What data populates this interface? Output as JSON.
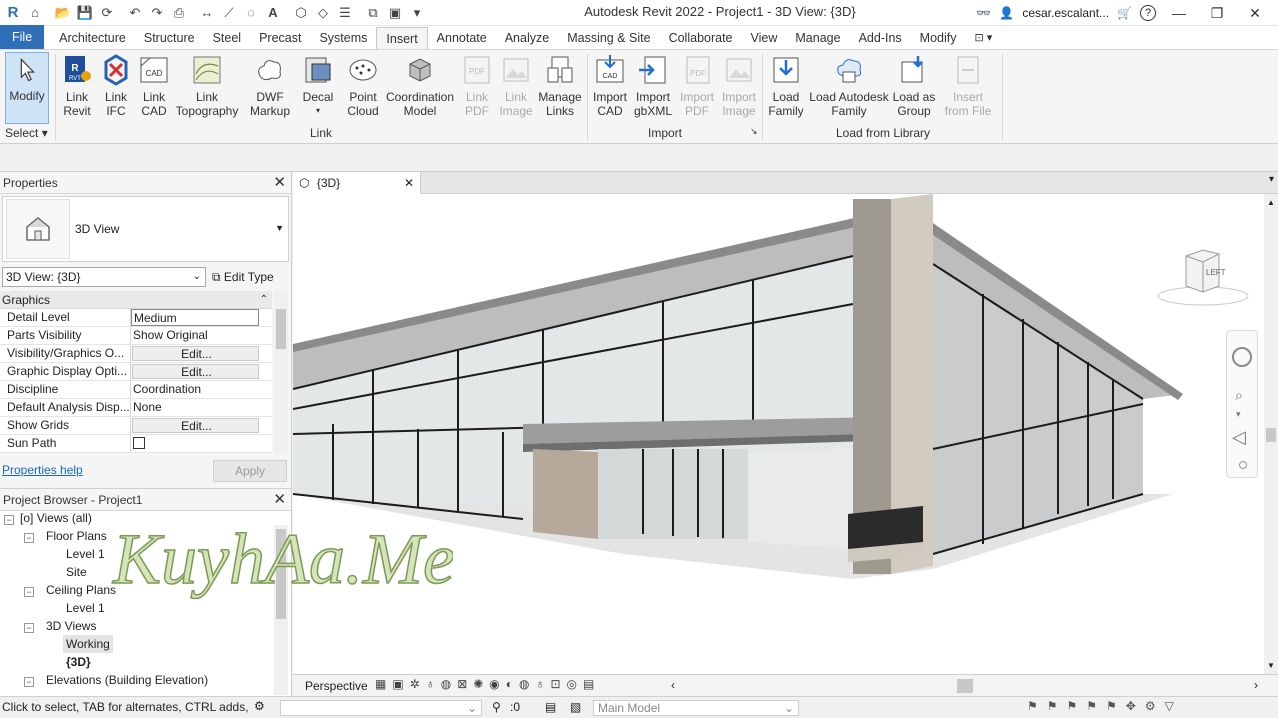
{
  "window": {
    "title": "Autodesk Revit 2022 - Project1 - 3D View: {3D}",
    "user": "cesar.escalant...",
    "app_icon": "R"
  },
  "tabs": [
    "File",
    "Architecture",
    "Structure",
    "Steel",
    "Precast",
    "Systems",
    "Insert",
    "Annotate",
    "Analyze",
    "Massing & Site",
    "Collaborate",
    "View",
    "Manage",
    "Add-Ins",
    "Modify"
  ],
  "active_tab": "Insert",
  "ribbon": {
    "modify": "Modify",
    "select_panel": "Select",
    "link_revit": [
      "Link",
      "Revit"
    ],
    "link_ifc": [
      "Link",
      "IFC"
    ],
    "link_cad": [
      "Link",
      "CAD"
    ],
    "link_topography": [
      "Link",
      "Topography"
    ],
    "dwf_markup": [
      "DWF",
      "Markup"
    ],
    "decal": "Decal",
    "point_cloud": [
      "Point",
      "Cloud"
    ],
    "coordination_model": [
      "Coordination",
      "Model"
    ],
    "link_pdf": [
      "Link",
      "PDF"
    ],
    "link_image": [
      "Link",
      "Image"
    ],
    "manage_links": [
      "Manage",
      "Links"
    ],
    "link_panel": "Link",
    "import_cad": [
      "Import",
      "CAD"
    ],
    "import_gbxml": [
      "Import",
      "gbXML"
    ],
    "import_pdf": [
      "Import",
      "PDF"
    ],
    "import_image": [
      "Import",
      "Image"
    ],
    "import_panel": "Import",
    "load_family": [
      "Load",
      "Family"
    ],
    "load_autodesk_family": [
      "Load Autodesk",
      "Family"
    ],
    "load_as_group": [
      "Load as",
      "Group"
    ],
    "insert_from_file": [
      "Insert",
      "from File"
    ],
    "load_panel": "Load from Library"
  },
  "properties": {
    "title": "Properties",
    "type_name": "3D View",
    "view_selector": "3D View: {3D}",
    "edit_type": "Edit Type",
    "group": "Graphics",
    "rows": [
      {
        "k": "Detail Level",
        "v": "Medium",
        "kind": "box"
      },
      {
        "k": "Parts Visibility",
        "v": "Show Original",
        "kind": "text"
      },
      {
        "k": "Visibility/Graphics O...",
        "v": "Edit...",
        "kind": "btn"
      },
      {
        "k": "Graphic Display Opti...",
        "v": "Edit...",
        "kind": "btn"
      },
      {
        "k": "Discipline",
        "v": "Coordination",
        "kind": "text"
      },
      {
        "k": "Default Analysis Disp...",
        "v": "None",
        "kind": "text"
      },
      {
        "k": "Show Grids",
        "v": "Edit...",
        "kind": "btn"
      },
      {
        "k": "Sun Path",
        "v": "",
        "kind": "check"
      }
    ],
    "help": "Properties help",
    "apply": "Apply"
  },
  "browser": {
    "title": "Project Browser - Project1",
    "items": {
      "views": "Views (all)",
      "floor_plans": "Floor Plans",
      "level1": "Level 1",
      "site": "Site",
      "ceiling_plans": "Ceiling Plans",
      "ceiling_level1": "Level 1",
      "views3d": "3D Views",
      "working": "Working",
      "view3d": "{3D}",
      "elevations": "Elevations (Building Elevation)"
    }
  },
  "viewport": {
    "tab": "{3D}",
    "viewcube_face": "LEFT",
    "projection": "Perspective"
  },
  "status": {
    "hint": "Click to select, TAB for alternates, CTRL adds, SHIFT unselects.",
    "zero": ":0",
    "model": "Main Model"
  },
  "watermark": "KuyhAa.Me",
  "colors": {
    "file_tab": "#2f6fb7",
    "accent": "#1a66c9",
    "modify_bg": "#cfe3f7"
  }
}
